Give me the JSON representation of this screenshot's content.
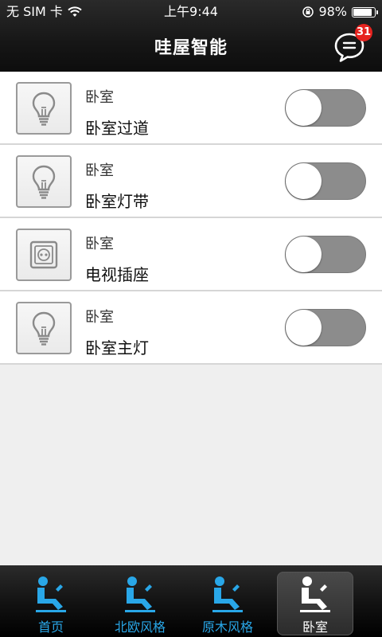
{
  "status_bar": {
    "carrier": "无 SIM 卡",
    "time": "上午9:44",
    "battery": "98%"
  },
  "header": {
    "title": "哇屋智能",
    "message_badge_count": "31"
  },
  "devices": [
    {
      "room": "卧室",
      "name": "卧室过道",
      "icon": "light-bulb-icon",
      "on": false
    },
    {
      "room": "卧室",
      "name": "卧室灯带",
      "icon": "light-bulb-icon",
      "on": false
    },
    {
      "room": "卧室",
      "name": "电视插座",
      "icon": "power-socket-icon",
      "on": false
    },
    {
      "room": "卧室",
      "name": "卧室主灯",
      "icon": "light-bulb-icon",
      "on": false
    }
  ],
  "tabs": [
    {
      "label": "首页",
      "icon": "seated-person-icon",
      "selected": false
    },
    {
      "label": "北欧风格",
      "icon": "seated-person-icon",
      "selected": false
    },
    {
      "label": "原木风格",
      "icon": "seated-person-icon",
      "selected": false
    },
    {
      "label": "卧室",
      "icon": "seated-person-icon",
      "selected": true
    }
  ],
  "colors": {
    "accent": "#29a7e8",
    "badge": "#e6231f",
    "toggle_off": "#8c8c8c"
  }
}
